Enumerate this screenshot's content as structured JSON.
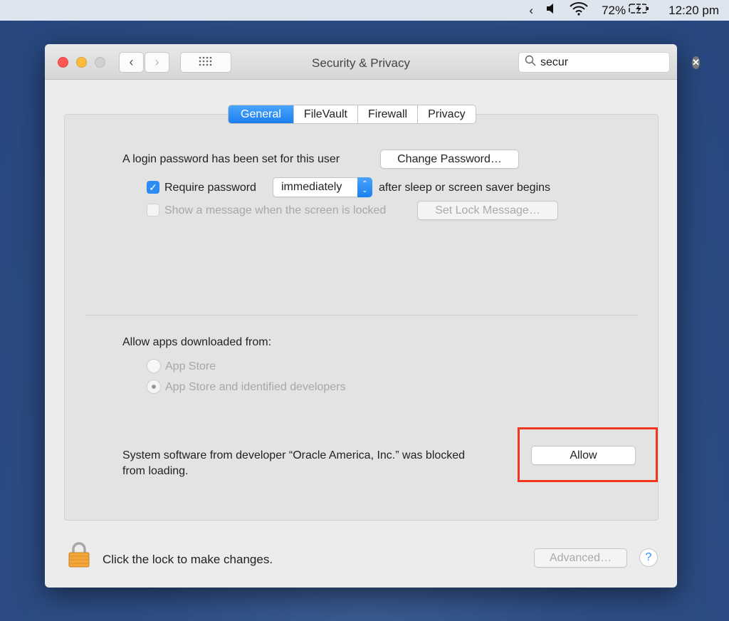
{
  "menubar": {
    "battery": "72%",
    "time": "12:20 pm"
  },
  "window": {
    "title": "Security & Privacy",
    "search": {
      "value": "secur"
    }
  },
  "tabs": [
    "General",
    "FileVault",
    "Firewall",
    "Privacy"
  ],
  "general": {
    "login_text": "A login password has been set for this user",
    "change_password": "Change Password…",
    "require_password_label": "Require password",
    "require_password_checked": true,
    "require_password_delay": "immediately",
    "after_sleep_text": "after sleep or screen saver begins",
    "show_message_label": "Show a message when the screen is locked",
    "show_message_checked": false,
    "set_lock_message": "Set Lock Message…",
    "allow_apps_label": "Allow apps downloaded from:",
    "options": [
      "App Store",
      "App Store and identified developers"
    ],
    "selected_option": "App Store and identified developers",
    "blocked_line1": "System software from developer “Oracle America, Inc.” was blocked",
    "blocked_line2": "from loading.",
    "allow": "Allow",
    "highlight_color": "#f0361f"
  },
  "footer": {
    "lock_text": "Click the lock to make changes.",
    "advanced": "Advanced…",
    "help": "?"
  }
}
